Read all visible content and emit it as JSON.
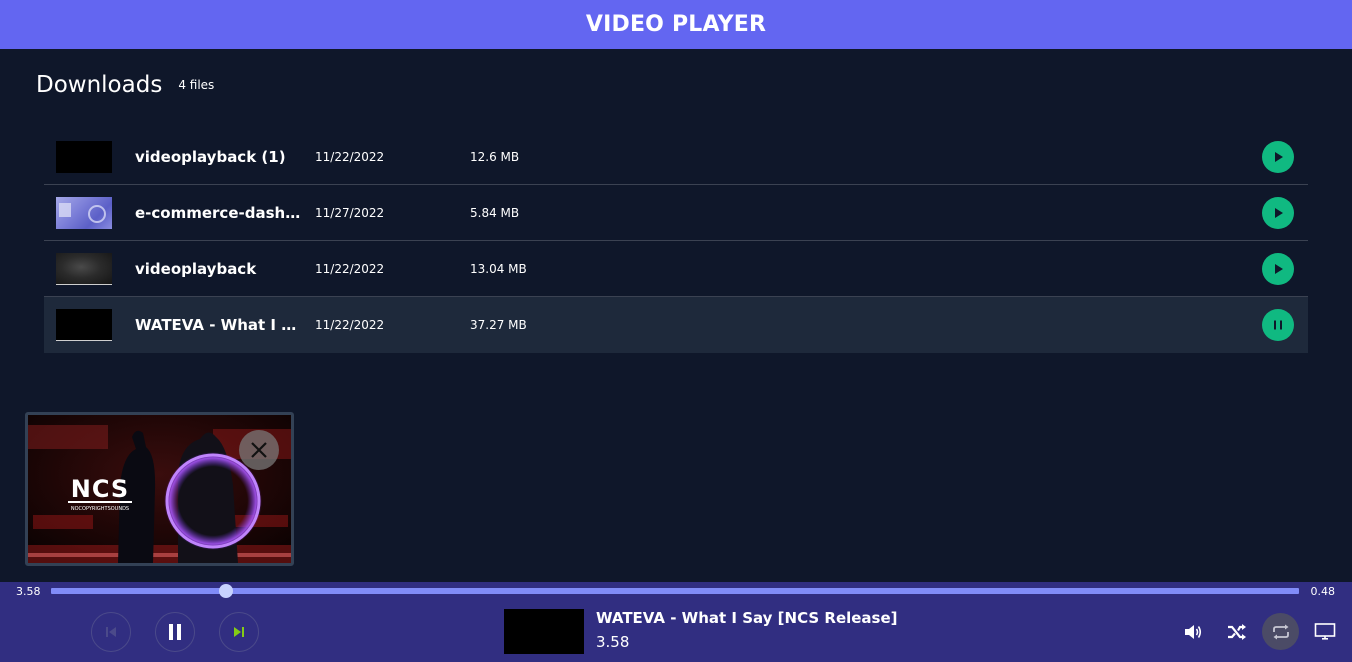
{
  "app": {
    "title": "VIDEO PLAYER"
  },
  "downloads": {
    "title": "Downloads",
    "count": "4 files",
    "files": [
      {
        "name": "videoplayback (1)",
        "date": "11/22/2022",
        "size": "12.6 MB",
        "state": "play"
      },
      {
        "name": "e-commerce-dashboard",
        "date": "11/27/2022",
        "size": "5.84 MB",
        "state": "play"
      },
      {
        "name": "videoplayback",
        "date": "11/22/2022",
        "size": "13.04 MB",
        "state": "play"
      },
      {
        "name": "WATEVA - What I Say [NCS Release]",
        "date": "11/22/2022",
        "size": "37.27 MB",
        "state": "playing"
      }
    ]
  },
  "mini_player": {
    "logo_text": "NCS",
    "logo_subtext": "NOCOPYRIGHTSOUNDS"
  },
  "player": {
    "elapsed": "3.58",
    "remaining": "0.48",
    "progress": 0.14,
    "now_playing": {
      "title": "WATEVA - What I Say [NCS Release]",
      "time": "3.58"
    }
  },
  "icons": {
    "play": "play-icon",
    "pause": "pause-icon",
    "close": "close-icon",
    "prev": "skip-previous-icon",
    "next": "skip-next-icon",
    "volume": "volume-icon",
    "shuffle": "shuffle-icon",
    "repeat": "repeat-icon",
    "screen": "monitor-icon"
  },
  "colors": {
    "header": "#6366f1",
    "background": "#0f172a",
    "accent": "#10b981",
    "player_bar": "#312e81",
    "progress": "#818cf8",
    "next_icon": "#84cc16"
  }
}
